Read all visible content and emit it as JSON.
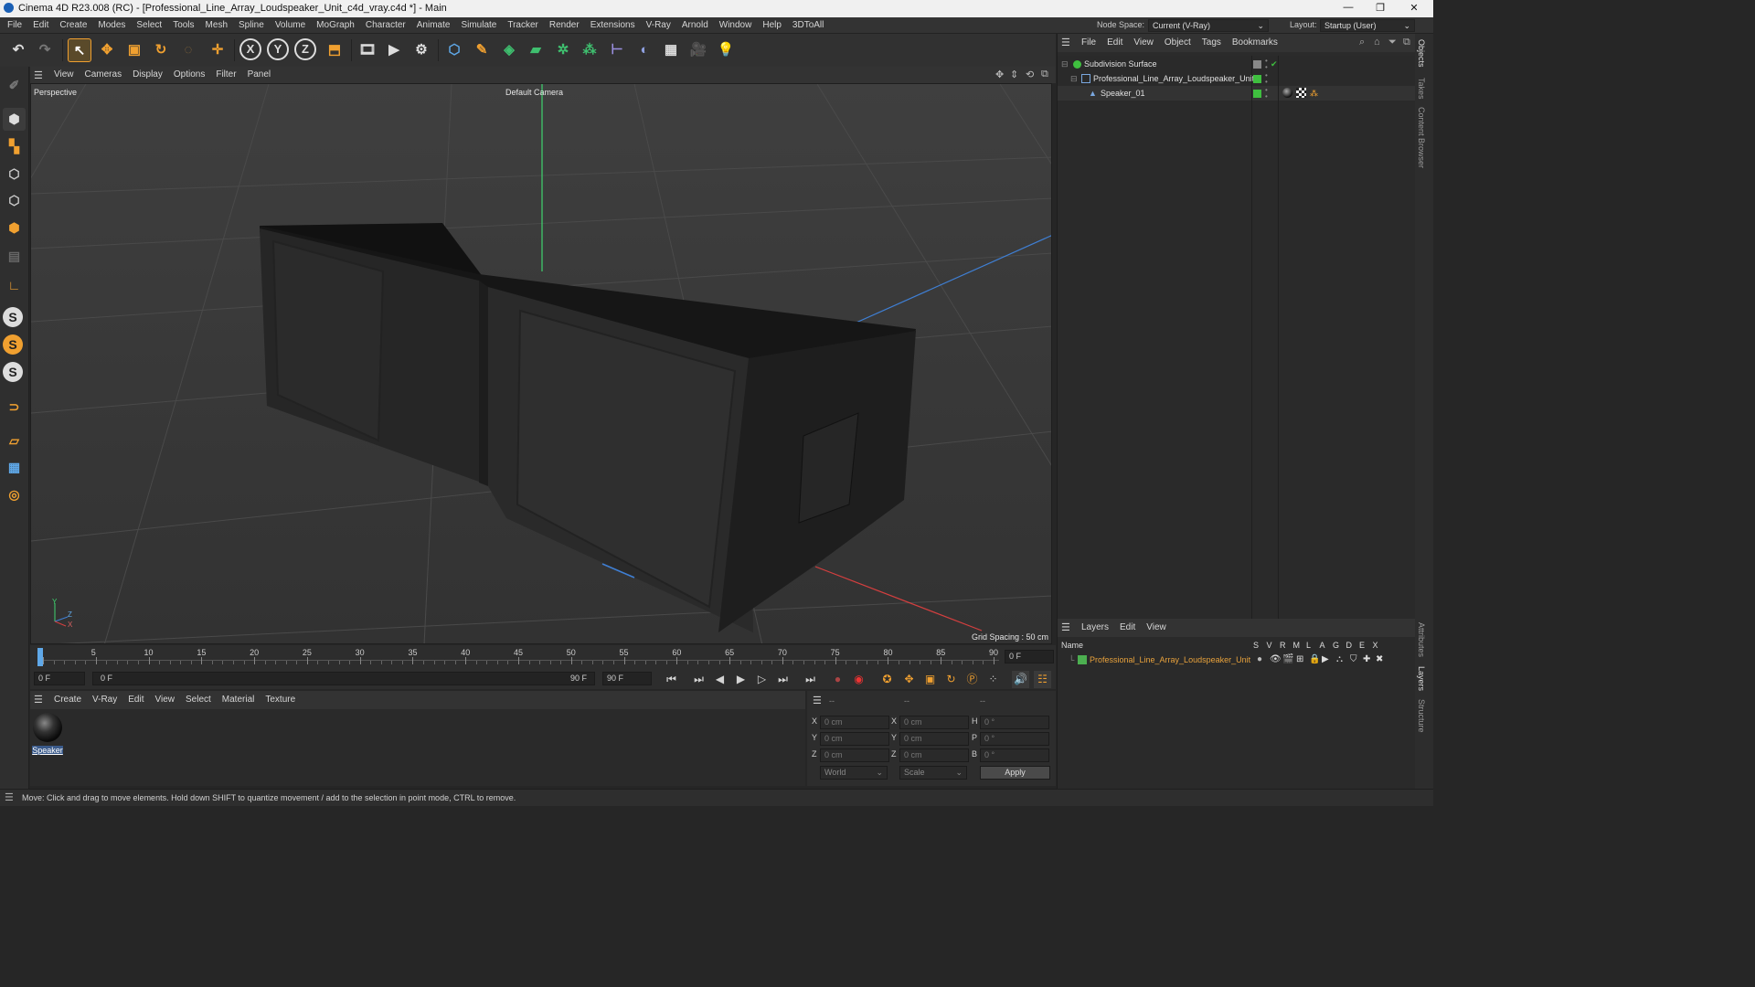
{
  "window": {
    "title": "Cinema 4D R23.008 (RC) - [Professional_Line_Array_Loudspeaker_Unit_c4d_vray.c4d *] - Main"
  },
  "menu": [
    "File",
    "Edit",
    "Create",
    "Modes",
    "Select",
    "Tools",
    "Mesh",
    "Spline",
    "Volume",
    "MoGraph",
    "Character",
    "Animate",
    "Simulate",
    "Tracker",
    "Render",
    "Extensions",
    "V-Ray",
    "Arnold",
    "Window",
    "Help",
    "3DToAll"
  ],
  "nodespace": {
    "label": "Node Space:",
    "value": "Current (V-Ray)"
  },
  "layout": {
    "label": "Layout:",
    "value": "Startup (User)"
  },
  "toolbar": {
    "x_axis": "X",
    "y_axis": "Y",
    "z_axis": "Z"
  },
  "viewport": {
    "menu": [
      "View",
      "Cameras",
      "Display",
      "Options",
      "Filter",
      "Panel"
    ],
    "label": "Perspective",
    "camera": "Default Camera",
    "grid_spacing": "Grid Spacing : 50 cm",
    "axis_x": "X",
    "axis_y": "Y",
    "axis_z": "Z"
  },
  "timeline": {
    "ticks": [
      "0",
      "5",
      "10",
      "15",
      "20",
      "25",
      "30",
      "35",
      "40",
      "45",
      "50",
      "55",
      "60",
      "65",
      "70",
      "75",
      "80",
      "85",
      "90"
    ],
    "current_frame": "0 F",
    "start": "0 F",
    "range_start": "0 F",
    "range_end": "90 F",
    "end": "90 F"
  },
  "material_manager": {
    "menu": [
      "Create",
      "V-Ray",
      "Edit",
      "View",
      "Select",
      "Material",
      "Texture"
    ],
    "materials": [
      {
        "name": "Speaker"
      }
    ]
  },
  "coords": {
    "headers": [
      "--",
      "--",
      "--"
    ],
    "rows": [
      {
        "a": "X",
        "av": "0 cm",
        "b": "X",
        "bv": "0 cm",
        "c": "H",
        "cv": "0 °"
      },
      {
        "a": "Y",
        "av": "0 cm",
        "b": "Y",
        "bv": "0 cm",
        "c": "P",
        "cv": "0 °"
      },
      {
        "a": "Z",
        "av": "0 cm",
        "b": "Z",
        "bv": "0 cm",
        "c": "B",
        "cv": "0 °"
      }
    ],
    "mode1": "World",
    "mode2": "Scale",
    "apply": "Apply"
  },
  "object_manager": {
    "menu": [
      "File",
      "Edit",
      "View",
      "Object",
      "Tags",
      "Bookmarks"
    ],
    "objects": [
      {
        "name": "Subdivision Surface"
      },
      {
        "name": "Professional_Line_Array_Loudspeaker_Unit"
      },
      {
        "name": "Speaker_01"
      }
    ]
  },
  "layer_manager": {
    "menu": [
      "Layers",
      "Edit",
      "View"
    ],
    "name_header": "Name",
    "columns": [
      "S",
      "V",
      "R",
      "M",
      "L",
      "A",
      "G",
      "D",
      "E",
      "X"
    ],
    "layers": [
      {
        "name": "Professional_Line_Array_Loudspeaker_Unit",
        "color": "#4caf50"
      }
    ]
  },
  "side_tabs": [
    "Objects",
    "Takes",
    "Content Browser",
    "Attributes",
    "Layers",
    "Structure"
  ],
  "status": "Move: Click and drag to move elements. Hold down SHIFT to quantize movement / add to the selection in point mode, CTRL to remove.",
  "colors": {
    "accent": "#f0a030",
    "layer_text": "#e8a23c",
    "green": "#3fbf3f"
  }
}
